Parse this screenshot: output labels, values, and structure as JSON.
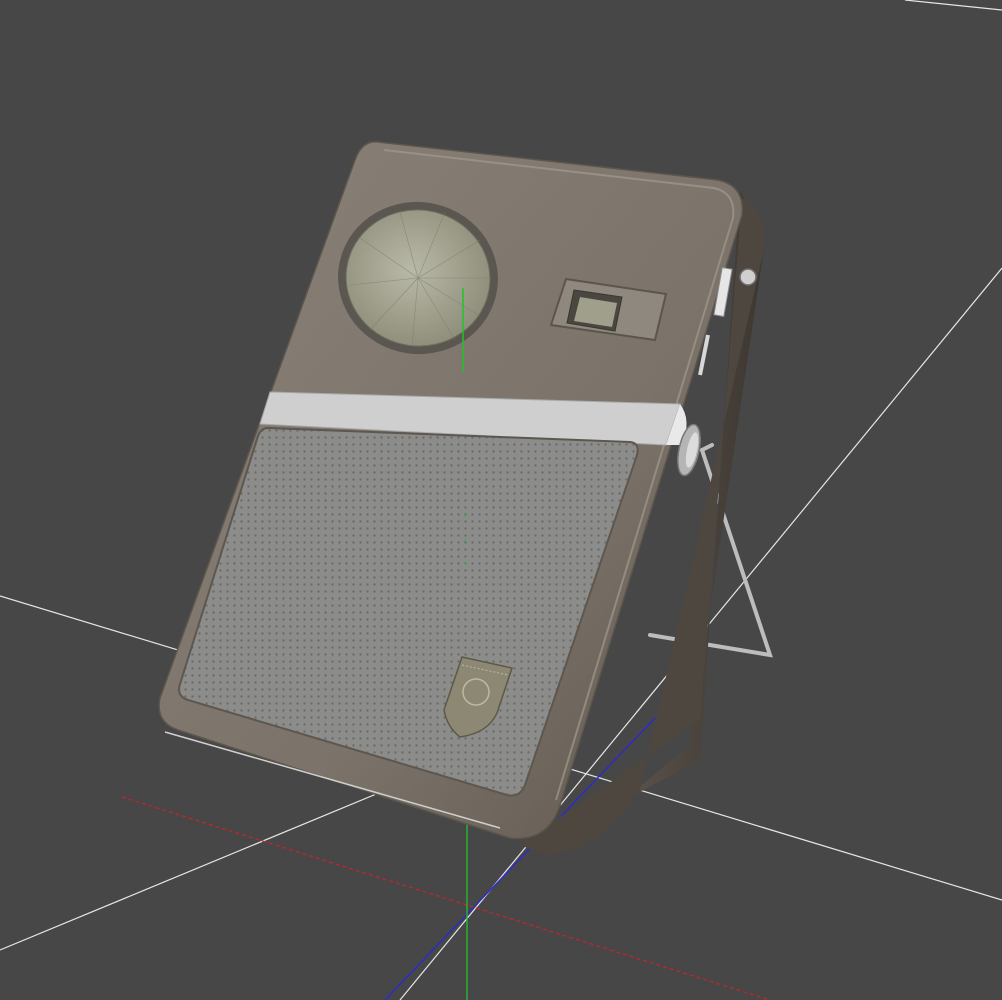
{
  "viewport": {
    "background": "#474747",
    "grid_color": "#e6e6e6",
    "axis_colors": {
      "x": "#c0262b",
      "y": "#22c22b",
      "z": "#2a2ad6"
    }
  },
  "model": {
    "body_color": "#7d756b",
    "speaker_grille_color": "#8b8c8a",
    "trim_color": "#cfcfcf",
    "dial_color": "#9a9a86",
    "stand_color": "#bdbdbd",
    "icons": [
      "radio-body",
      "tuning-dial",
      "tuning-window",
      "speaker-grille",
      "badge-emblem",
      "wire-stand",
      "volume-knob"
    ]
  }
}
